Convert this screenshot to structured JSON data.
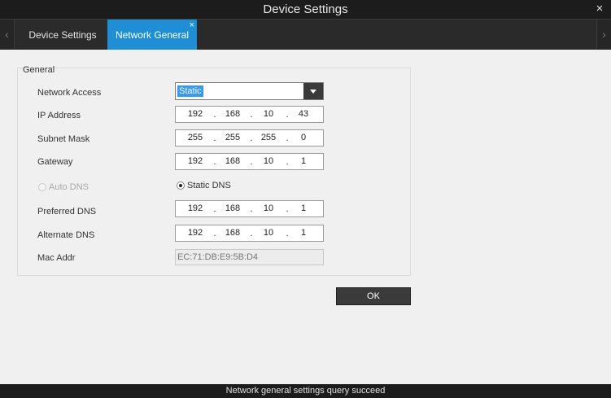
{
  "window": {
    "title": "Device Settings",
    "close_glyph": "×"
  },
  "tabs": {
    "left_arrow": "‹",
    "right_arrow": "›",
    "items": [
      {
        "label": "Device Settings",
        "active": false
      },
      {
        "label": "Network General",
        "active": true,
        "close_glyph": "×"
      }
    ]
  },
  "general": {
    "title": "General",
    "network_access": {
      "label": "Network Access",
      "value": "Static"
    },
    "ip_address": {
      "label": "IP Address",
      "octets": [
        "192",
        "168",
        "10",
        "43"
      ]
    },
    "subnet_mask": {
      "label": "Subnet Mask",
      "octets": [
        "255",
        "255",
        "255",
        "0"
      ]
    },
    "gateway": {
      "label": "Gateway",
      "octets": [
        "192",
        "168",
        "10",
        "1"
      ]
    },
    "auto_dns": {
      "label": "Auto DNS",
      "checked": false,
      "enabled": false
    },
    "static_dns": {
      "label": "Static DNS",
      "checked": true,
      "enabled": true
    },
    "preferred_dns": {
      "label": "Preferred DNS",
      "octets": [
        "192",
        "168",
        "10",
        "1"
      ]
    },
    "alternate_dns": {
      "label": "Alternate DNS",
      "octets": [
        "192",
        "168",
        "10",
        "1"
      ]
    },
    "mac_addr": {
      "label": "Mac Addr",
      "value": "EC:71:DB:E9:5B:D4"
    },
    "ip_separator": "."
  },
  "buttons": {
    "ok_label": "OK"
  },
  "status": {
    "text": "Network general settings query succeed"
  },
  "colors": {
    "accent": "#1e8fd5",
    "title_bg": "#1c1c1c",
    "content_bg": "#f0f0f0"
  }
}
